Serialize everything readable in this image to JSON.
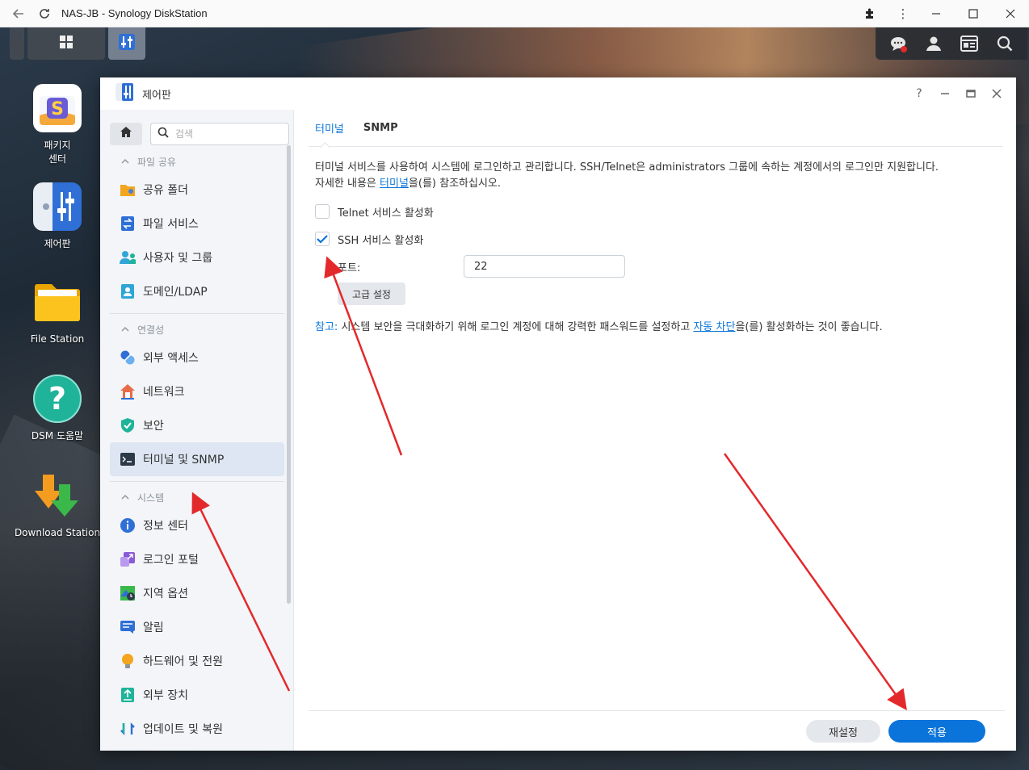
{
  "browser": {
    "title": "NAS-JB - Synology DiskStation"
  },
  "desktop": {
    "icons": [
      {
        "label": "패키지\n센터"
      },
      {
        "label": "제어판"
      },
      {
        "label": "File Station"
      },
      {
        "label": "DSM 도움말"
      },
      {
        "label": "Download Station"
      }
    ]
  },
  "window": {
    "title": "제어판"
  },
  "sidebar": {
    "search_placeholder": "검색",
    "sections": [
      {
        "label": "파일 공유",
        "items": [
          "공유 폴더",
          "파일 서비스",
          "사용자 및 그룹",
          "도메인/LDAP"
        ]
      },
      {
        "label": "연결성",
        "items": [
          "외부 액세스",
          "네트워크",
          "보안",
          "터미널 및 SNMP"
        ]
      },
      {
        "label": "시스템",
        "items": [
          "정보 센터",
          "로그인 포털",
          "지역 옵션",
          "알림",
          "하드웨어 및 전원",
          "외부 장치",
          "업데이트 및 복원"
        ]
      }
    ],
    "active_item": "터미널 및 SNMP"
  },
  "content": {
    "tabs": [
      {
        "label": "터미널"
      },
      {
        "label": "SNMP"
      }
    ],
    "desc_line1": "터미널 서비스를 사용하여 시스템에 로그인하고 관리합니다. SSH/Telnet은 administrators 그룹에 속하는 계정에서의 로그인만 지원합니다.",
    "desc_line2_pre": "자세한 내용은 ",
    "desc_line2_link": "터미널",
    "desc_line2_post": "을(를) 참조하십시오.",
    "telnet_label": "Telnet 서비스 활성화",
    "telnet_checked": false,
    "ssh_label": "SSH 서비스 활성화",
    "ssh_checked": true,
    "port_label": "포트:",
    "port_value": "22",
    "advanced_label": "고급 설정",
    "note_label": "참고:",
    "note_pre": " 시스템 보안을 극대화하기 위해 로그인 계정에 대해 강력한 패스워드를 설정하고 ",
    "note_link": "자동 차단",
    "note_post": "을(를) 활성화하는 것이 좋습니다.",
    "reset_label": "재설정",
    "apply_label": "적용"
  },
  "colors": {
    "accent": "#0a74da",
    "annotation": "#e3292b"
  }
}
